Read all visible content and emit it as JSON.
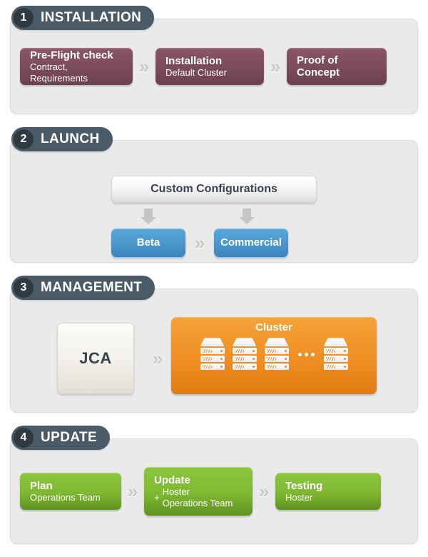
{
  "theme": {
    "badge_bg": "#4a5a66",
    "badge_num_bg": "#2e3940",
    "panel_bg": "#eaeaea",
    "maroon": "#7d4d5d",
    "blue": "#4a98ce",
    "green": "#7eb832",
    "orange": "#ef8e22",
    "chevron": "#c9c9c9"
  },
  "stages": [
    {
      "number": "1",
      "title": "INSTALLATION",
      "boxes": [
        {
          "title": "Pre-Flight check",
          "sub": "Contract, Requirements"
        },
        {
          "title": "Installation",
          "sub": "Default Cluster"
        },
        {
          "title": "Proof of Concept",
          "sub": ""
        }
      ],
      "separator": "»"
    },
    {
      "number": "2",
      "title": "LAUNCH",
      "top_box": {
        "title": "Custom Configurations"
      },
      "branch_left_icon": "elbow-arrow-down-left-icon",
      "branch_right_icon": "elbow-arrow-down-right-icon",
      "boxes": [
        {
          "title": "Beta"
        },
        {
          "title": "Commercial"
        }
      ],
      "separator": "»"
    },
    {
      "number": "3",
      "title": "MANAGEMENT",
      "source_box": {
        "title": "JCA"
      },
      "cluster": {
        "title": "Cluster",
        "server_count_shown": 4,
        "ellipsis_after_index": 3,
        "ellipsis": "•••",
        "rack_units_per_server": 3
      },
      "separator": "»"
    },
    {
      "number": "4",
      "title": "UPDATE",
      "boxes": [
        {
          "title": "Plan",
          "sub": "Operations Team"
        },
        {
          "title": "Update",
          "plus": "+",
          "sub_line1": "Hoster",
          "sub_line2": "Operations Team"
        },
        {
          "title": "Testing",
          "sub": "Hoster"
        }
      ],
      "separator": "»"
    }
  ]
}
